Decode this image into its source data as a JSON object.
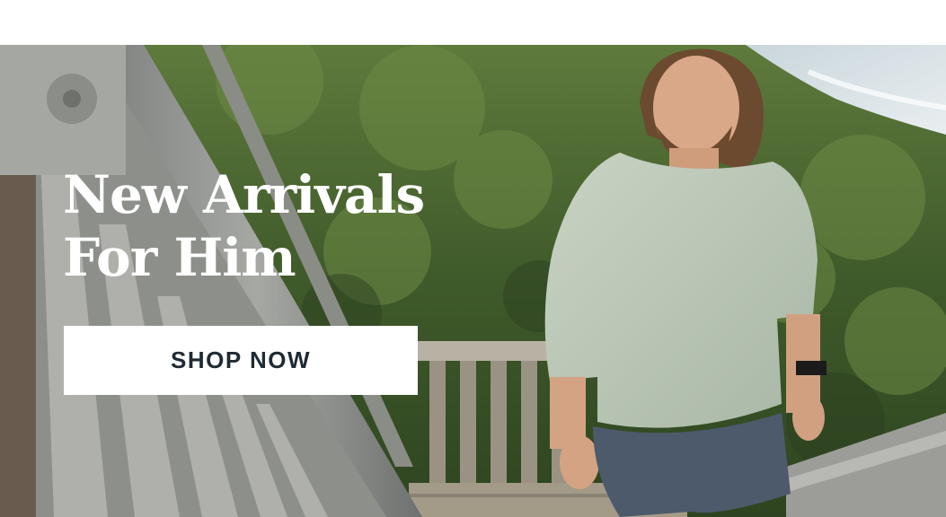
{
  "hero": {
    "headline_line1": "New Arrivals",
    "headline_line2": "For Him",
    "cta_label": "SHOP NOW"
  },
  "colors": {
    "headline": "#ffffff",
    "cta_background": "#ffffff",
    "cta_text": "#1f2a33"
  }
}
